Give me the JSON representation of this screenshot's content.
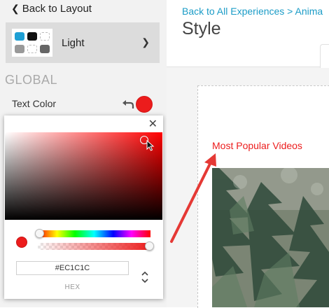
{
  "sidebar": {
    "back_label": "Back to Layout",
    "theme": {
      "name": "Light"
    },
    "section_label": "GLOBAL",
    "text_color": {
      "label": "Text Color",
      "value": "#EC1C1C"
    }
  },
  "picker": {
    "close_icon": "close-icon",
    "hex_value": "#EC1C1C",
    "hex_label": "HEX",
    "hue": 0,
    "alpha": 1
  },
  "main": {
    "breadcrumb": "Back to All Experiences > Anima",
    "title": "Style",
    "section_heading": "Most Popular Videos"
  },
  "colors": {
    "accent": "#1B9CC7",
    "selected_color": "#EC1C1C",
    "annotation_arrow": "#E53935"
  }
}
